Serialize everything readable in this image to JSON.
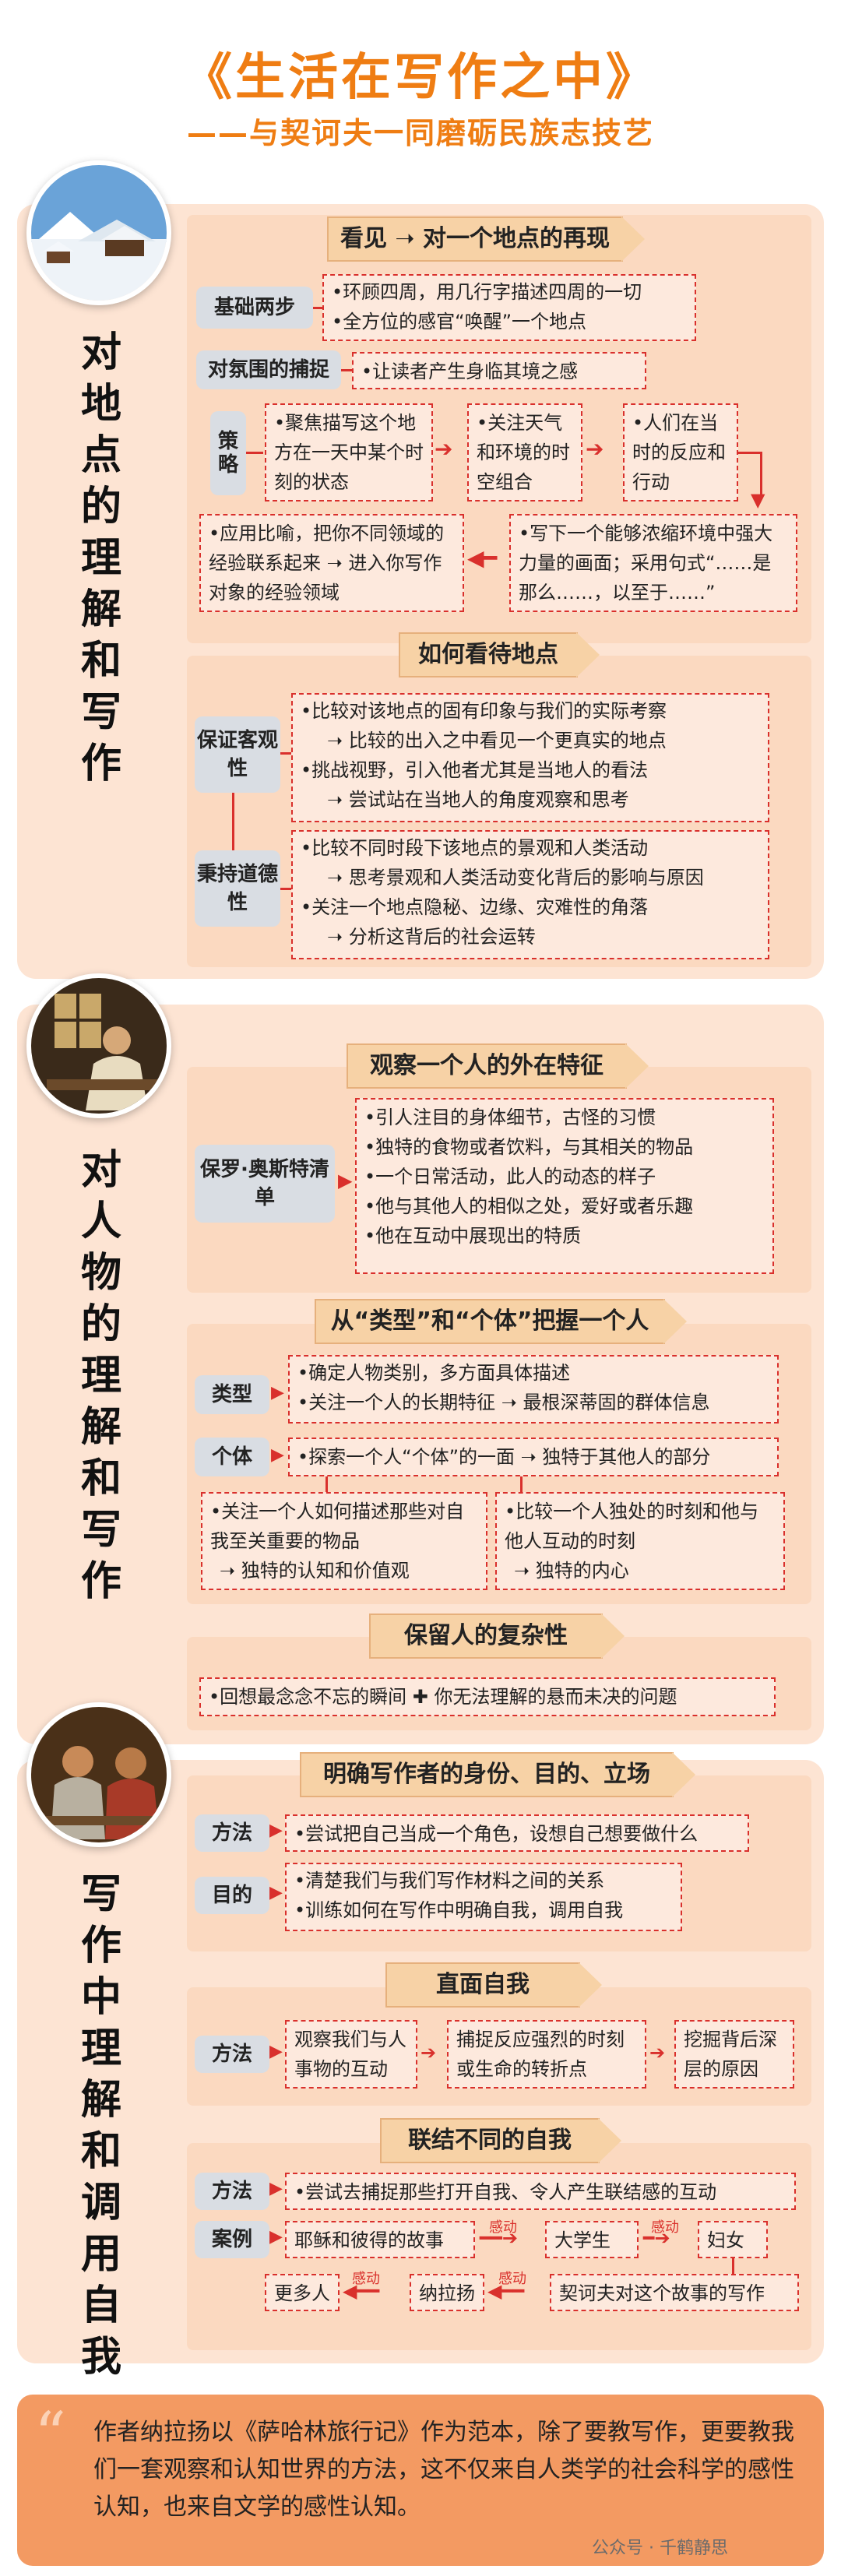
{
  "header": {
    "title": "《生活在写作之中》",
    "subtitle": "——与契诃夫一同磨砺民族志技艺"
  },
  "s1": {
    "side": "对地点的理解和写作",
    "banner1": "看见 ➝ 对一个地点的再现",
    "basic_label": "基础两步",
    "basic_1": "•环顾四周，用几行字描述四周的一切",
    "basic_2": "•全方位的感官“唤醒”一个地点",
    "atmos_label": "对氛围的捕捉",
    "atmos_text": "•让读者产生身临其境之感",
    "strategy_label": "策略",
    "st1": "•聚焦描写这个地方在一天中某个时刻的状态",
    "st2": "•关注天气和环境的时空组合",
    "st3": "•人们在当时的反应和行动",
    "st4": "•应用比喻，把你不同领域的经验联系起来 ➝ 进入你写作对象的经验领域",
    "st5": "•写下一个能够浓缩环境中强大力量的画面；采用句式“……是那么……，以至于……”",
    "banner2": "如何看待地点",
    "obj_label": "保证客观性",
    "obj_1": "•比较对该地点的固有印象与我们的实际考察",
    "obj_2": "➝ 比较的出入之中看见一个更真实的地点",
    "obj_3": "•挑战视野，引入他者尤其是当地人的看法",
    "obj_4": "➝ 尝试站在当地人的角度观察和思考",
    "eth_label": "秉持道德性",
    "eth_1": "•比较不同时段下该地点的景观和人类活动",
    "eth_2": "➝ 思考景观和人类活动变化背后的影响与原因",
    "eth_3": "•关注一个地点隐秘、边缘、灾难性的角落",
    "eth_4": "➝ 分析这背后的社会运转"
  },
  "s2": {
    "side": "对人物的理解和写作",
    "banner1": "观察一个人的外在特征",
    "paul_label": "保罗·奥斯特清单",
    "paul_items": [
      "•引人注目的身体细节，古怪的习惯",
      "•独特的食物或者饮料，与其相关的物品",
      "•一个日常活动，此人的动态的样子",
      "•他与其他人的相似之处，爱好或者乐趣",
      "•他在互动中展现出的特质"
    ],
    "banner2": "从“类型”和“个体”把握一个人",
    "type_label": "类型",
    "type_1": "•确定人物类别，多方面具体描述",
    "type_2": "•关注一个人的长期特征 ➝ 最根深蒂固的群体信息",
    "indiv_label": "个体",
    "indiv_text": "•探索一个人“个体”的一面 ➝ 独特于其他人的部分",
    "left_1": "•关注一个人如何描述那些对自我至关重要的物品",
    "left_2": "➝ 独特的认知和价值观",
    "right_1": "•比较一个人独处的时刻和他与他人互动的时刻",
    "right_2": "➝ 独特的内心",
    "banner3": "保留人的复杂性",
    "complex": "•回想最念念不忘的瞬间 ✚ 你无法理解的悬而未决的问题"
  },
  "s3": {
    "side": "写作中理解和调用自我",
    "banner1": "明确写作者的身份、目的、立场",
    "method_label": "方法",
    "method_text": "•尝试把自己当成一个角色，设想自己想要做什么",
    "purpose_label": "目的",
    "purpose_1": "•清楚我们与我们写作材料之间的关系",
    "purpose_2": "•训练如何在写作中明确自我，调用自我",
    "banner2": "直面自我",
    "m2_label": "方法",
    "m2_a": "观察我们与人事物的互动",
    "m2_b": "捕捉反应强烈的时刻或生命的转折点",
    "m2_c": "挖掘背后深层的原因",
    "banner3": "联结不同的自我",
    "m3_label": "方法",
    "m3_text": "•尝试去捕捉那些打开自我、令人产生联结感的互动",
    "case_label": "案例",
    "c1": "耶稣和彼得的故事",
    "c2": "大学生",
    "c3": "妇女",
    "c4": "契诃夫对这个故事的写作",
    "c5": "纳拉扬",
    "c6": "更多人",
    "moved": "感动"
  },
  "quote": {
    "mark": "“",
    "text": "作者纳拉扬以《萨哈林旅行记》作为范本，除了要教写作，更要教我们一套观察和认知世界的方法，这不仅来自人类学的社会科学的感性认知，也来自文学的感性认知。",
    "watermark": "公众号 · 千鹤静思"
  }
}
